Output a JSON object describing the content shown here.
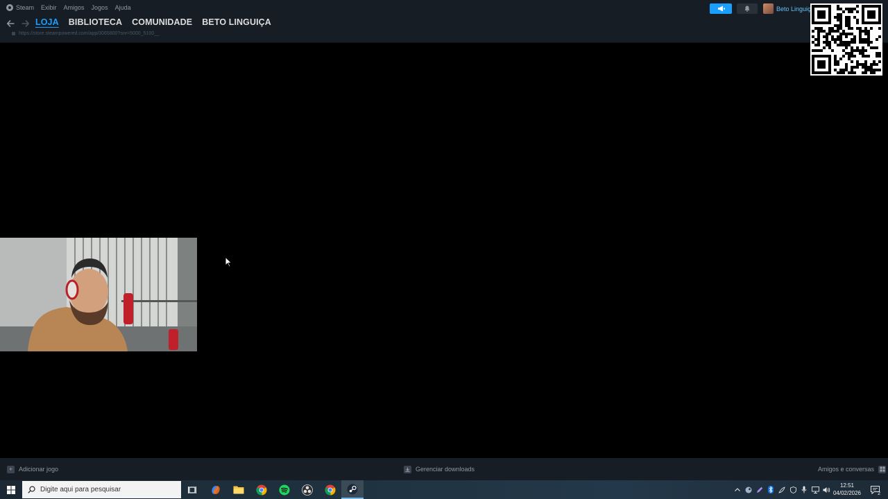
{
  "menubar": {
    "items": [
      "Steam",
      "Exibir",
      "Amigos",
      "Jogos",
      "Ajuda"
    ],
    "username": "Beto Linguiç",
    "colors": {
      "accent": "#1a9fff",
      "username": "#66c0f4",
      "bar_bg": "#171d25"
    }
  },
  "nav": {
    "tabs": [
      "LOJA",
      "BIBLIOTECA",
      "COMUNIDADE",
      "BETO LINGUIÇA"
    ],
    "active_tab": "LOJA",
    "url": "https://store.steampowered.com/app/3065800?snr=5000_5100__"
  },
  "bottom_bar": {
    "add_game": "Adicionar jogo",
    "manage_downloads": "Gerenciar downloads",
    "friends_chat": "Amigos e conversas"
  },
  "taskbar": {
    "search_placeholder": "Digite aqui para pesquisar",
    "apps": [
      "task-view-icon",
      "copilot-icon",
      "file-explorer-icon",
      "chrome-icon",
      "spotify-icon",
      "obs-icon",
      "chrome-icon",
      "steam-icon"
    ],
    "active_app": "steam-icon",
    "time": "12:51",
    "date": "04/02/2026",
    "notification_count": "2"
  },
  "overlays": {
    "qr_code": "qr-code-icon",
    "webcam": "webcam-feed"
  }
}
